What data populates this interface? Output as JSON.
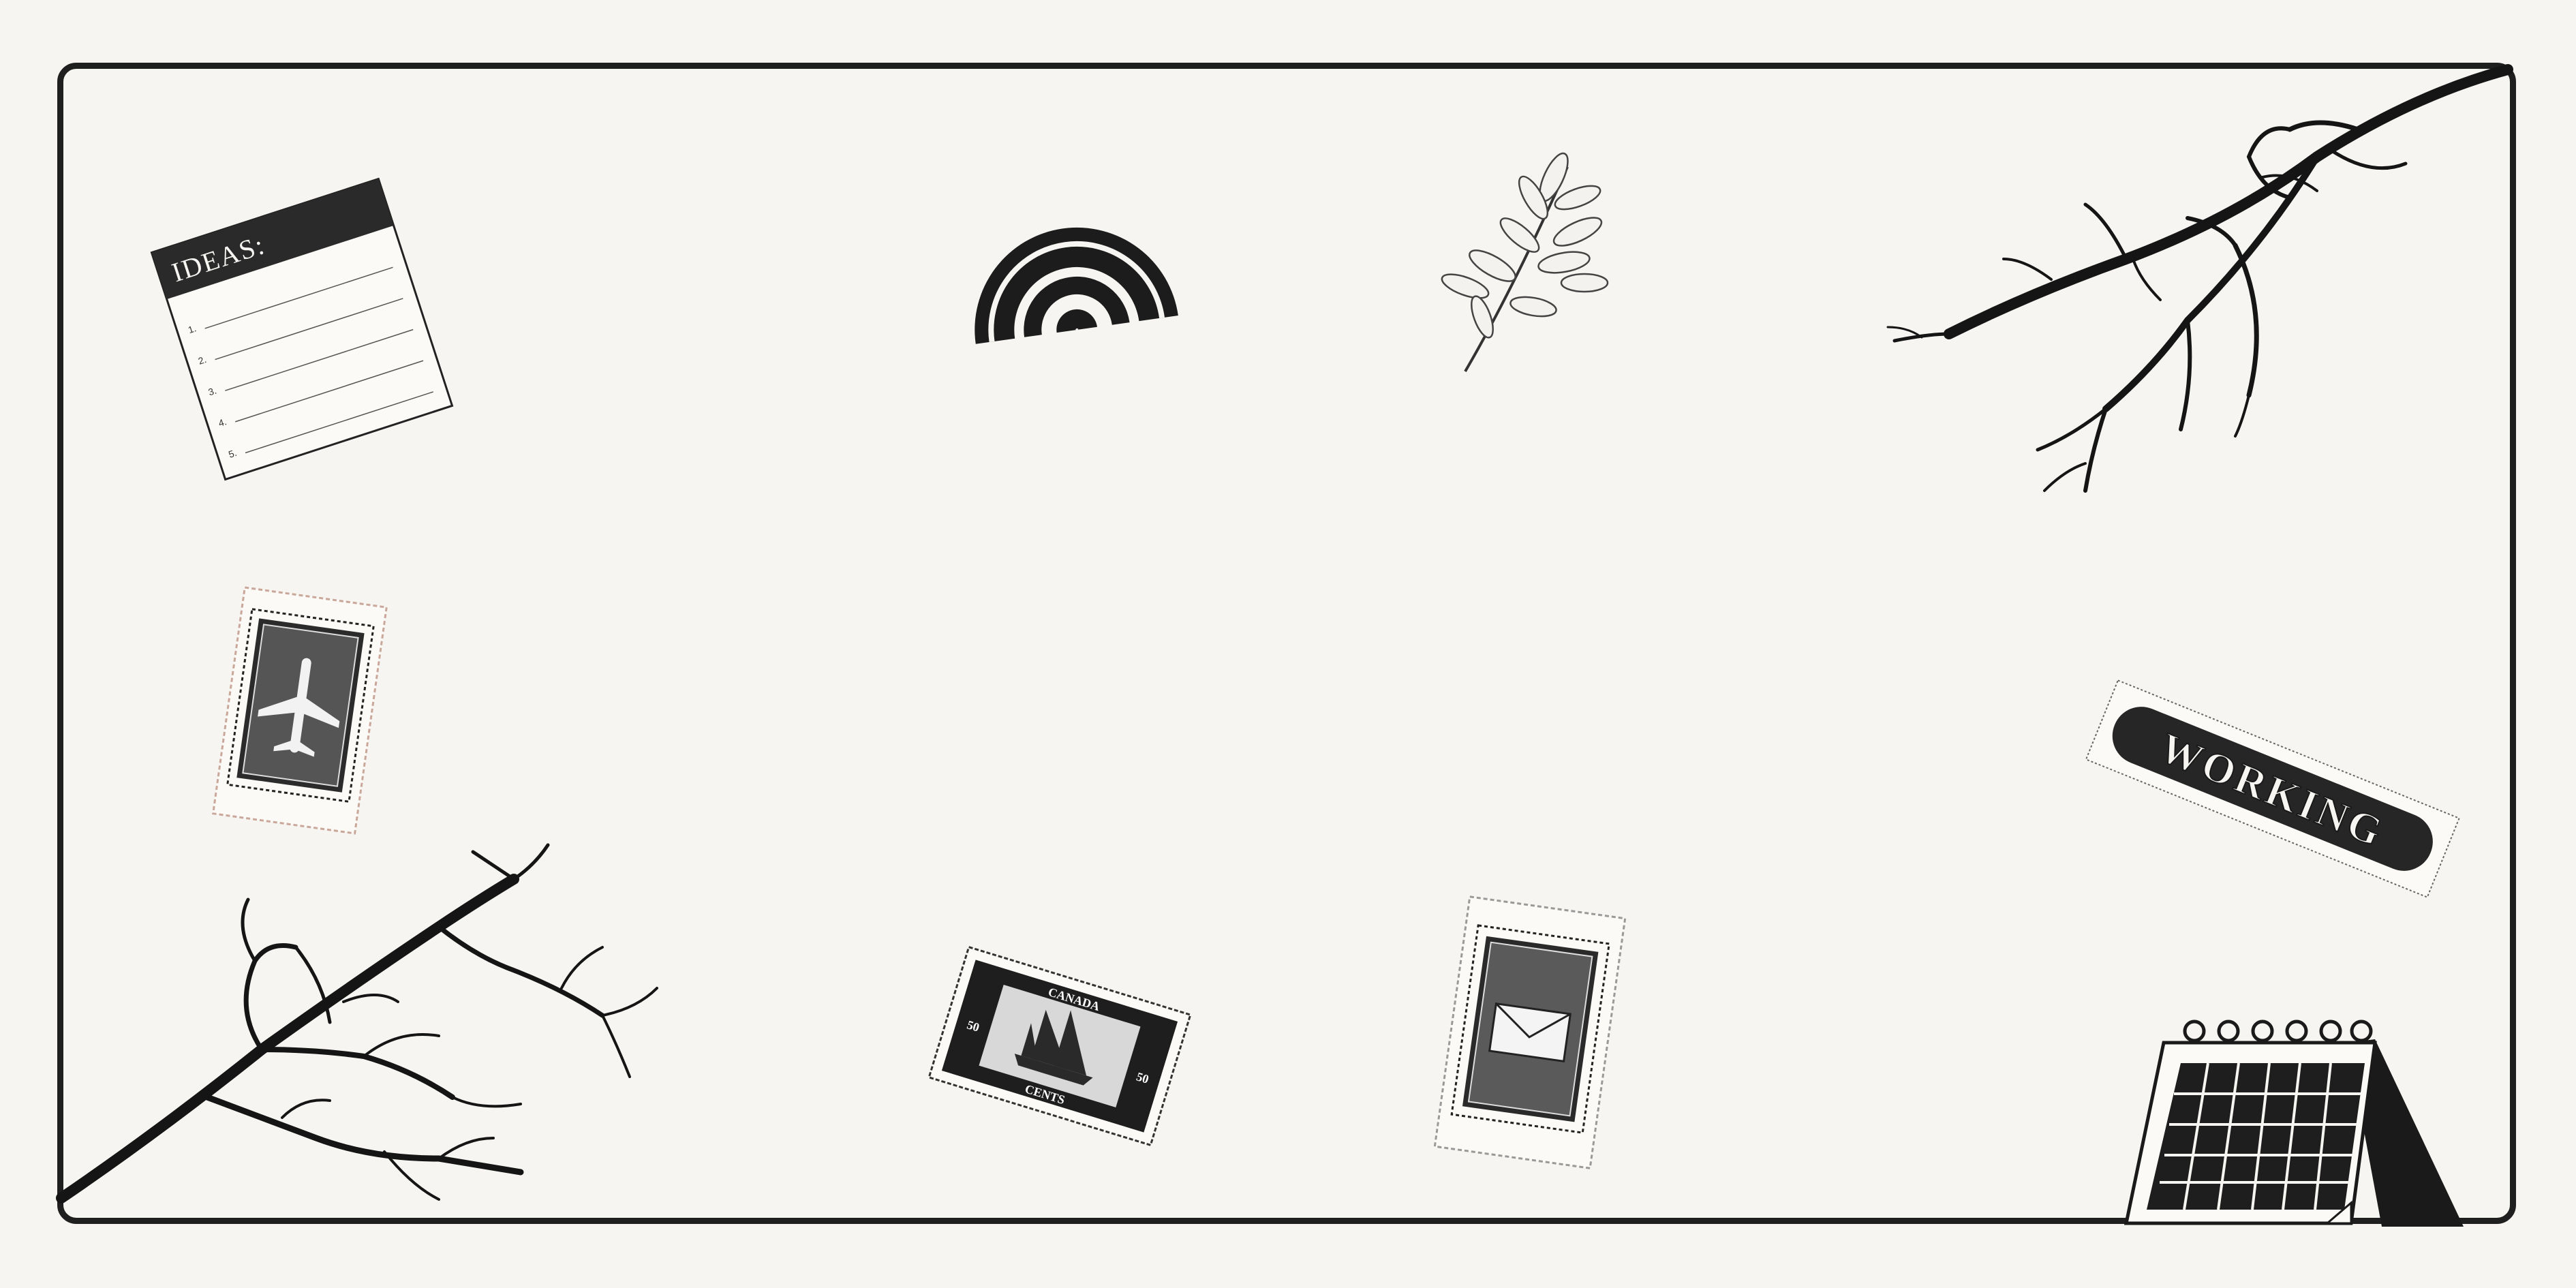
{
  "canvas": {
    "background": "#f6f5f1",
    "ink": "#1a1a1a"
  },
  "ideas_note": {
    "title": "IDEAS:",
    "numbers": [
      "1.",
      "2.",
      "3.",
      "4.",
      "5."
    ]
  },
  "stamp_ship": {
    "country": "CANADA",
    "value_left": "50",
    "value_right": "50",
    "unit": "CENTS"
  },
  "bandage": {
    "label": "WORKING"
  },
  "icons": [
    "rainbow-icon",
    "leaf-sprig-icon",
    "branch-icon",
    "airplane-stamp-icon",
    "envelope-stamp-icon",
    "calendar-icon"
  ]
}
